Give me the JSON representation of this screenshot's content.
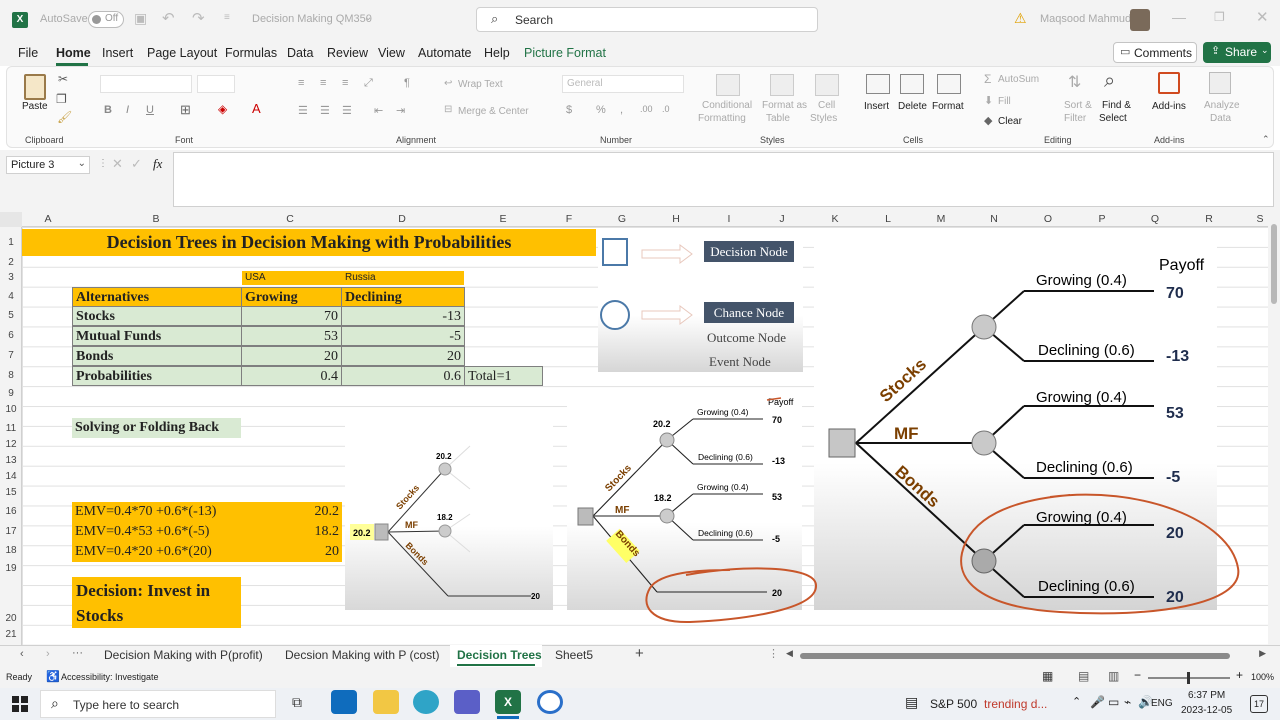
{
  "titlebar": {
    "autosave": "AutoSave",
    "autosave_state": "Off",
    "filename": "Decision Making QM350",
    "search_placeholder": "Search",
    "user": "Maqsood Mahmud"
  },
  "menu": [
    "File",
    "Home",
    "Insert",
    "Page Layout",
    "Formulas",
    "Data",
    "Review",
    "View",
    "Automate",
    "Help",
    "Picture Format"
  ],
  "buttons": {
    "comments": "Comments",
    "share": "Share"
  },
  "ribbon": {
    "paste": "Paste",
    "clipboard": "Clipboard",
    "font": "Font",
    "alignment": "Alignment",
    "number": "Number",
    "styles": "Styles",
    "cells": "Cells",
    "editing": "Editing",
    "addins": "Add-ins",
    "wrap_text": "Wrap Text",
    "merge_center": "Merge & Center",
    "number_format": "General",
    "conditional": "Conditional",
    "formatting": "Formatting",
    "format_as": "Format as",
    "table": "Table",
    "cell": "Cell",
    "styles_btn": "Styles",
    "insert": "Insert",
    "delete": "Delete",
    "format": "Format",
    "autosum": "AutoSum",
    "fill": "Fill",
    "clear": "Clear",
    "sort": "Sort &",
    "filter": "Filter",
    "find": "Find &",
    "select": "Select",
    "addins_btn": "Add-ins",
    "analyze": "Analyze",
    "data": "Data"
  },
  "namebox": "Picture 3",
  "fx": "fx",
  "columns": [
    "A",
    "B",
    "C",
    "D",
    "E",
    "F",
    "G",
    "H",
    "I",
    "J",
    "K",
    "L",
    "M",
    "N",
    "O",
    "P",
    "Q",
    "R",
    "S"
  ],
  "rows": [
    "1",
    "2",
    "3",
    "4",
    "5",
    "6",
    "7",
    "8",
    "9",
    "10",
    "11",
    "12",
    "13",
    "14",
    "15",
    "16",
    "17",
    "18",
    "19",
    "20",
    "21"
  ],
  "sheet": {
    "title": "Decision Trees in Decision Making with Probabilities",
    "usa": "USA",
    "russia": "Russia",
    "alternatives": "Alternatives",
    "growing": "Growing",
    "declining": "Declining",
    "stocks": "Stocks",
    "stocks_g": "70",
    "stocks_d": "-13",
    "mf": "Mutual Funds",
    "mf_g": "53",
    "mf_d": "-5",
    "bonds": "Bonds",
    "bonds_g": "20",
    "bonds_d": "20",
    "prob": "Probabilities",
    "prob_g": "0.4",
    "prob_d": "0.6",
    "total": "Total=1",
    "solving": "Solving or Folding Back",
    "emv1": "EMV=0.4*70 +0.6*(-13)",
    "emv1_v": "20.2",
    "emv2": "EMV=0.4*53 +0.6*(-5)",
    "emv2_v": "18.2",
    "emv3": "EMV=0.4*20 +0.6*(20)",
    "emv3_v": "20",
    "decision": "Decision: Invest in Stocks"
  },
  "legend": {
    "decision_node": "Decision Node",
    "chance_node": "Chance Node",
    "outcome_node": "Outcome Node",
    "event_node": "Event Node"
  },
  "tree_small": {
    "root": "20.2",
    "n1": "20.2",
    "n2": "18.2",
    "stocks": "Stocks",
    "mf": "MF",
    "bonds": "Bonds",
    "end": "20"
  },
  "tree_mid": {
    "payoff": "Payoff",
    "n1": "20.2",
    "n2": "18.2",
    "stocks": "Stocks",
    "mf": "MF",
    "bonds": "Bonds",
    "g1": "Growing (0.4)",
    "d1": "Declining (0.6)",
    "g2": "Growing (0.4)",
    "d2": "Declining (0.6)",
    "v1": "70",
    "v2": "-13",
    "v3": "53",
    "v4": "-5",
    "v5": "20"
  },
  "tree_big": {
    "payoff": "Payoff",
    "stocks": "Stocks",
    "mf": "MF",
    "bonds": "Bonds",
    "g1": "Growing (0.4)",
    "d1": "Declining (0.6)",
    "g2": "Growing (0.4)",
    "d2": "Declining (0.6)",
    "g3": "Growing (0.4)",
    "d3": "Declining (0.6)",
    "v1": "70",
    "v2": "-13",
    "v3": "53",
    "v4": "-5",
    "v5": "20",
    "v6": "20"
  },
  "tabs": [
    "Decision Making with P(profit)",
    "Decsion Making with P (cost)",
    "Decision Trees",
    "Sheet5"
  ],
  "status": {
    "ready": "Ready",
    "accessibility": "Accessibility: Investigate",
    "zoom": "100%"
  },
  "taskbar": {
    "search": "Type here to search",
    "stock": "S&P 500",
    "trending": "trending d...",
    "lang": "ENG",
    "time": "6:37 PM",
    "date": "2023-12-05",
    "notif": "17"
  },
  "colors": {
    "excel_green": "#217346",
    "orange": "#ffc000",
    "green_cell": "#d9ead3",
    "annotation": "#c8562a"
  }
}
